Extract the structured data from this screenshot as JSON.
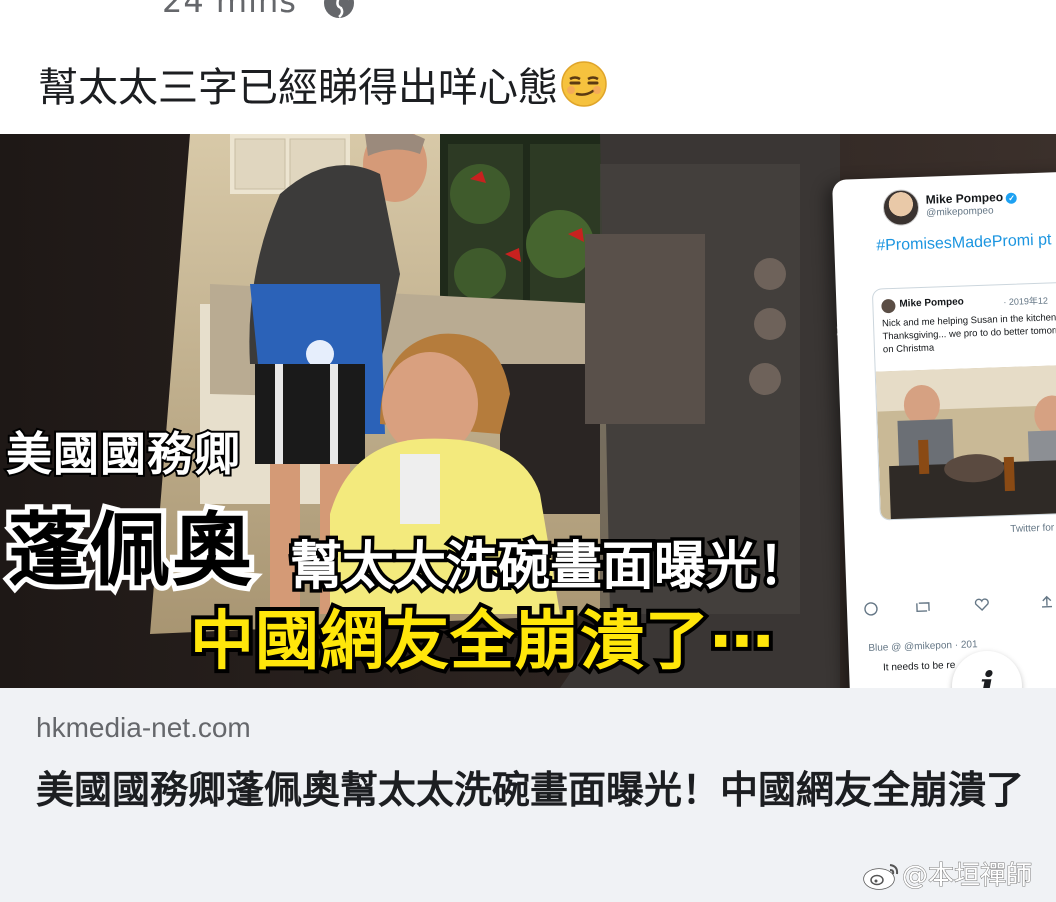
{
  "post": {
    "time": "24 mins",
    "privacy_icon": "globe-icon",
    "caption": "幫太太三字已經睇得出咩心態",
    "caption_emoji": "smirking-face-emoji"
  },
  "preview_image": {
    "overlay_line1": "美國國務卿",
    "overlay_line2": "蓬佩奧",
    "overlay_line3": "幫太太洗碗畫面曝光！",
    "overlay_line4": "中國網友全崩潰了⋯",
    "colors": {
      "yellow_text": "#ffe60a",
      "hashtag_blue": "#1b95e0"
    },
    "tweet": {
      "name": "Mike Pompeo",
      "handle": "@mikepompeo",
      "hashtag": "#PromisesMadePromi pt",
      "quoted_name": "Mike Pompeo",
      "quoted_date": "· 2019年12",
      "quoted_text": "Nick and me helping Susan in the kitchen over Thanksgiving... we pro to do better tomorrow on Christma",
      "source": "Twitter for",
      "reply_handle": "Blue @ @mikepon · 201",
      "reply_text": "It needs to be re"
    },
    "info_icon": "info-icon"
  },
  "link": {
    "domain": "hkmedia-net.com",
    "title": "美國國務卿蓬佩奧幫太太洗碗畫面曝光！中國網友全崩潰了"
  },
  "watermark": {
    "text": "@本垣禪師",
    "logo": "weibo-logo"
  }
}
